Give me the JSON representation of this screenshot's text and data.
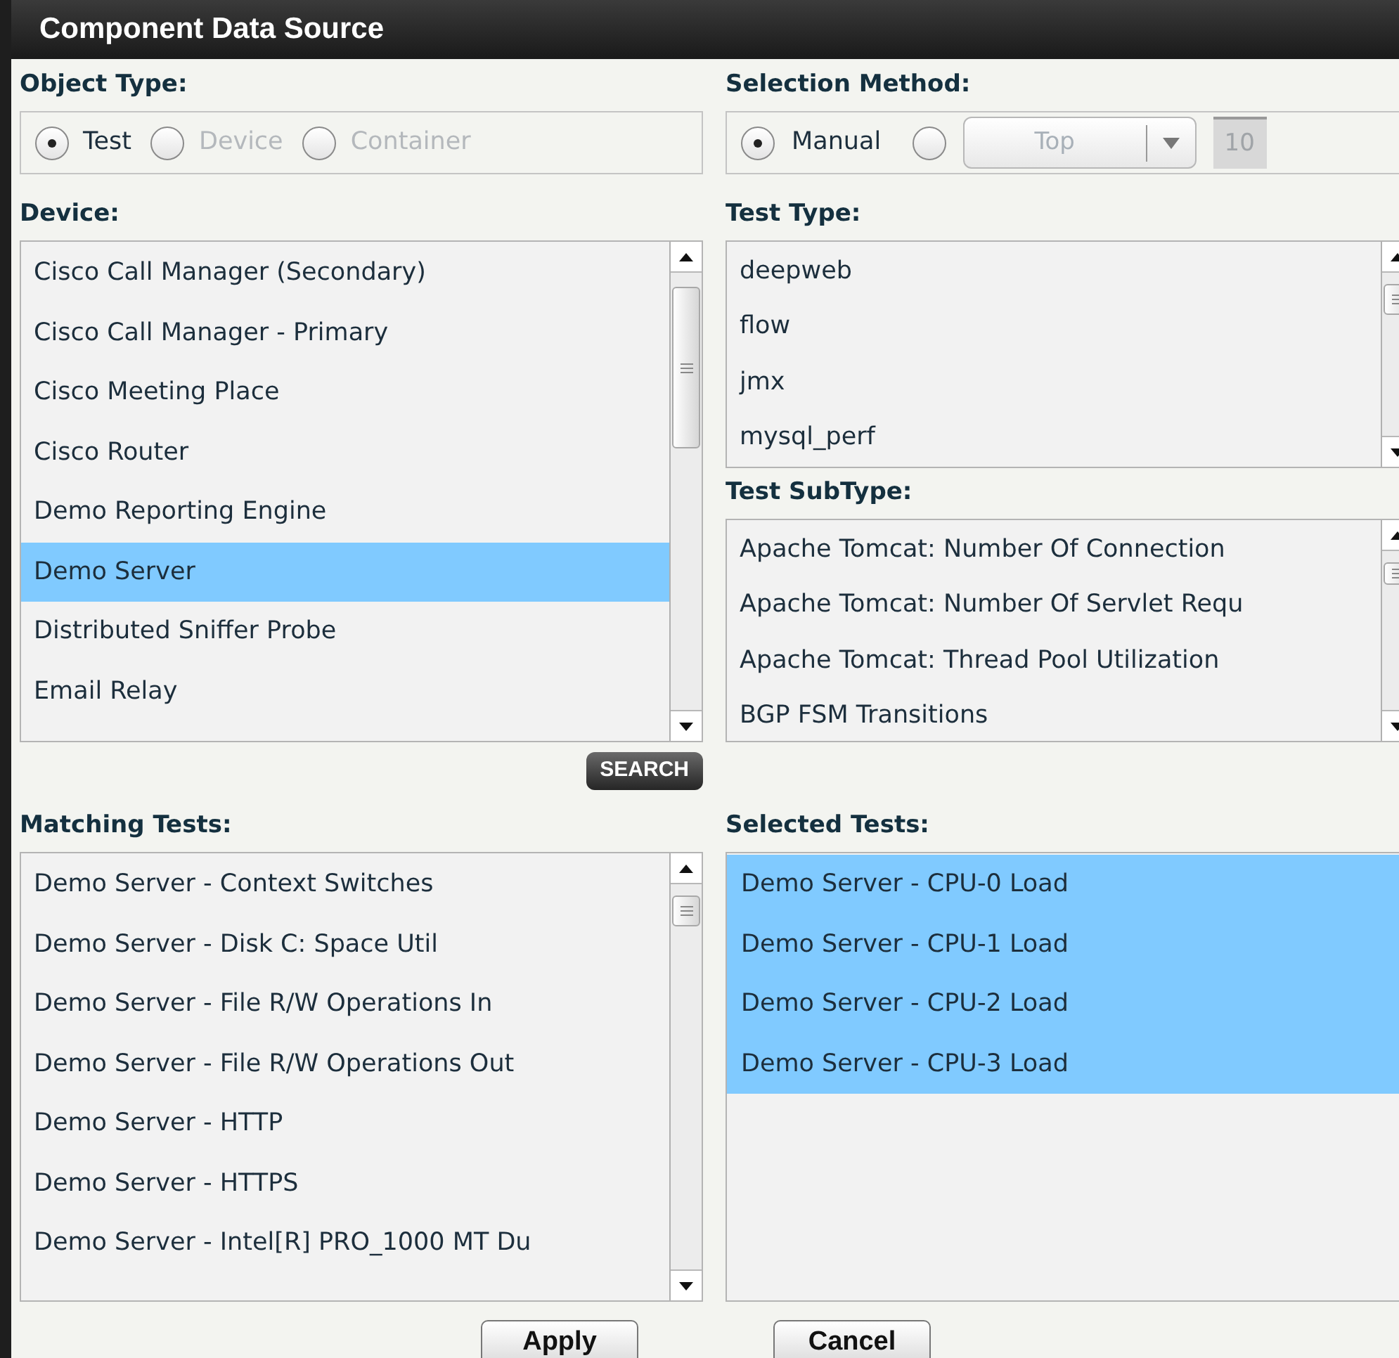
{
  "window": {
    "title": "Component Data Source"
  },
  "object_type": {
    "label": "Object Type:",
    "options": [
      {
        "label": "Test",
        "selected": true,
        "disabled": false
      },
      {
        "label": "Device",
        "selected": false,
        "disabled": true
      },
      {
        "label": "Container",
        "selected": false,
        "disabled": true
      }
    ]
  },
  "selection_method": {
    "label": "Selection Method:",
    "manual": {
      "label": "Manual",
      "selected": true
    },
    "top": {
      "selected": false
    },
    "top_dropdown": {
      "value": "Top",
      "disabled": true
    },
    "count_field": {
      "value": "10",
      "disabled": true
    }
  },
  "device": {
    "label": "Device:",
    "items": [
      {
        "text": "Cisco Call Manager (Secondary)",
        "selected": false
      },
      {
        "text": "Cisco Call Manager - Primary",
        "selected": false
      },
      {
        "text": "Cisco Meeting Place",
        "selected": false
      },
      {
        "text": "Cisco Router",
        "selected": false
      },
      {
        "text": "Demo Reporting Engine",
        "selected": false
      },
      {
        "text": "Demo Server",
        "selected": true
      },
      {
        "text": "Distributed Sniffer Probe",
        "selected": false
      },
      {
        "text": "Email Relay",
        "selected": false
      }
    ]
  },
  "search_button": "SEARCH",
  "test_type": {
    "label": "Test Type:",
    "items": [
      {
        "text": "deepweb",
        "selected": false
      },
      {
        "text": "flow",
        "selected": false
      },
      {
        "text": "jmx",
        "selected": false
      },
      {
        "text": "mysql_perf",
        "selected": false
      }
    ]
  },
  "test_subtype": {
    "label": "Test SubType:",
    "items": [
      {
        "text": "Apache Tomcat: Number Of Connection",
        "selected": false
      },
      {
        "text": "Apache Tomcat: Number Of Servlet Requ",
        "selected": false
      },
      {
        "text": "Apache Tomcat: Thread Pool Utilization",
        "selected": false
      },
      {
        "text": "BGP FSM Transitions",
        "selected": false
      }
    ]
  },
  "matching_tests": {
    "label": "Matching Tests:",
    "items": [
      {
        "text": "Demo Server - Context Switches",
        "selected": false
      },
      {
        "text": "Demo Server - Disk C: Space Util",
        "selected": false
      },
      {
        "text": "Demo Server - File R/W Operations In",
        "selected": false
      },
      {
        "text": "Demo Server - File R/W Operations Out",
        "selected": false
      },
      {
        "text": "Demo Server - HTTP",
        "selected": false
      },
      {
        "text": "Demo Server - HTTPS",
        "selected": false
      },
      {
        "text": "Demo Server - Intel[R] PRO_1000 MT Du",
        "selected": false
      }
    ]
  },
  "selected_tests": {
    "label": "Selected Tests:",
    "items": [
      {
        "text": "Demo Server - CPU-0 Load",
        "selected": true
      },
      {
        "text": "Demo Server - CPU-1 Load",
        "selected": true
      },
      {
        "text": "Demo Server - CPU-2 Load",
        "selected": true
      },
      {
        "text": "Demo Server - CPU-3 Load",
        "selected": true
      }
    ]
  },
  "buttons": [
    "Apply",
    "Cancel"
  ]
}
